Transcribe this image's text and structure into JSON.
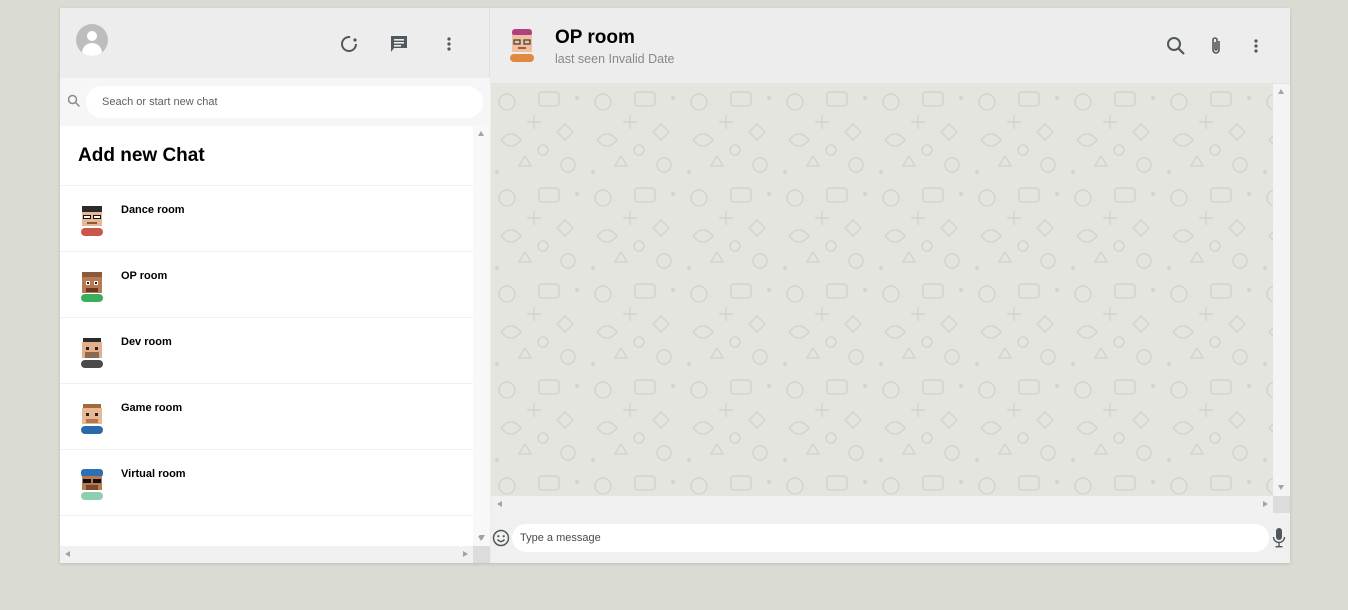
{
  "sidebar": {
    "search": {
      "placeholder": "Seach or start new chat"
    },
    "add_chat_label": "Add new Chat",
    "rooms": [
      {
        "name": "Dance room"
      },
      {
        "name": "OP room"
      },
      {
        "name": "Dev room"
      },
      {
        "name": "Game room"
      },
      {
        "name": "Virtual room"
      }
    ]
  },
  "chat": {
    "room_name": "OP room",
    "last_seen": "last seen Invalid Date",
    "input": {
      "placeholder": "Type a message"
    }
  },
  "colors": {
    "header_bg": "#ededed",
    "chat_bg": "#e5e5df",
    "icon": "#51585c"
  }
}
